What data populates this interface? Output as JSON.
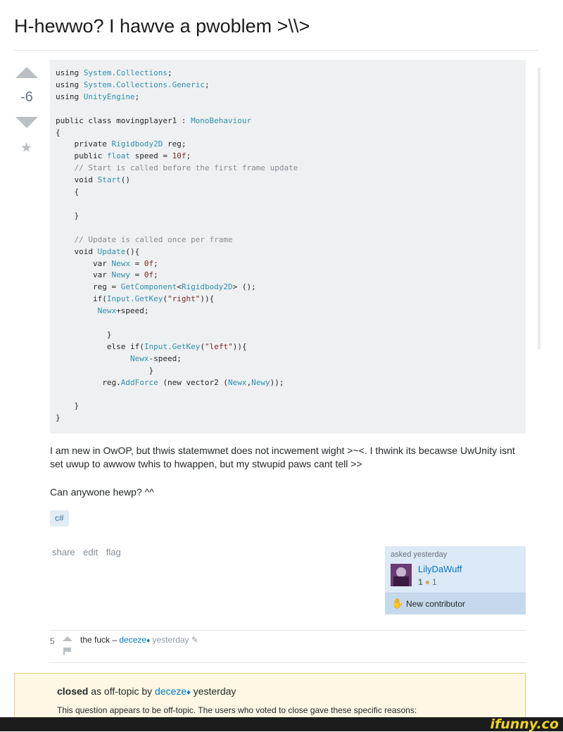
{
  "question": {
    "title": "H-hewwo? I hawve a pwoblem >\\\\>",
    "score": "-6",
    "body_p1": "I am new in OwOP, but thwis statemwnet does not incwement wight >~<. I thwink its becawse UwUnity isnt set uwup to awwow twhis to hwappen, but my stwupid paws cant tell >>",
    "body_p2": "Can anywone hewp? ^^",
    "tag": "c#"
  },
  "code_lines": [
    "using System.Collections;",
    "using System.Collections.Generic;",
    "using UnityEngine;",
    "",
    "public class movingplayer1 : MonoBehaviour",
    "{",
    "    private Rigidbody2D reg;",
    "    public float speed = 10f;",
    "    // Start is called before the first frame update",
    "    void Start()",
    "    {",
    "",
    "    }",
    "",
    "    // Update is called once per frame",
    "    void Update(){",
    "        var Newx = 0f;",
    "        var Newy = 0f;",
    "        reg = GetComponent<Rigidbody2D> ();",
    "        if(Input.GetKey(\"right\")){",
    "         Newx+speed;",
    "",
    "           }",
    "           else if(Input.GetKey(\"left\")){",
    "                Newx-speed;",
    "                    }",
    "          reg.AddForce (new vector2 (Newx,Newy));",
    "",
    "    }",
    "}"
  ],
  "post_menu": {
    "share": "share",
    "edit": "edit",
    "flag": "flag"
  },
  "owner": {
    "asked": "asked yesterday",
    "name": "LilyDaWuff",
    "reputation": "1",
    "badges": "1",
    "contributor_label": "New contributor"
  },
  "comment": {
    "score": "5",
    "text": "the fuck –",
    "user": "deceze",
    "diamond": "♦",
    "time": "yesterday"
  },
  "closed": {
    "status": "closed",
    "as": "as off-topic by",
    "user": "deceze",
    "diamond": "♦",
    "time": "yesterday",
    "reason": "This question appears to be off-topic. The users who voted to close gave these specific reasons:"
  },
  "watermark": "ifunny.co",
  "colors": {
    "link": "#0077cc",
    "type": "#2b91af",
    "comment": "#858c93",
    "string": "#7d2727",
    "closed_bg": "#fdf7e3"
  }
}
